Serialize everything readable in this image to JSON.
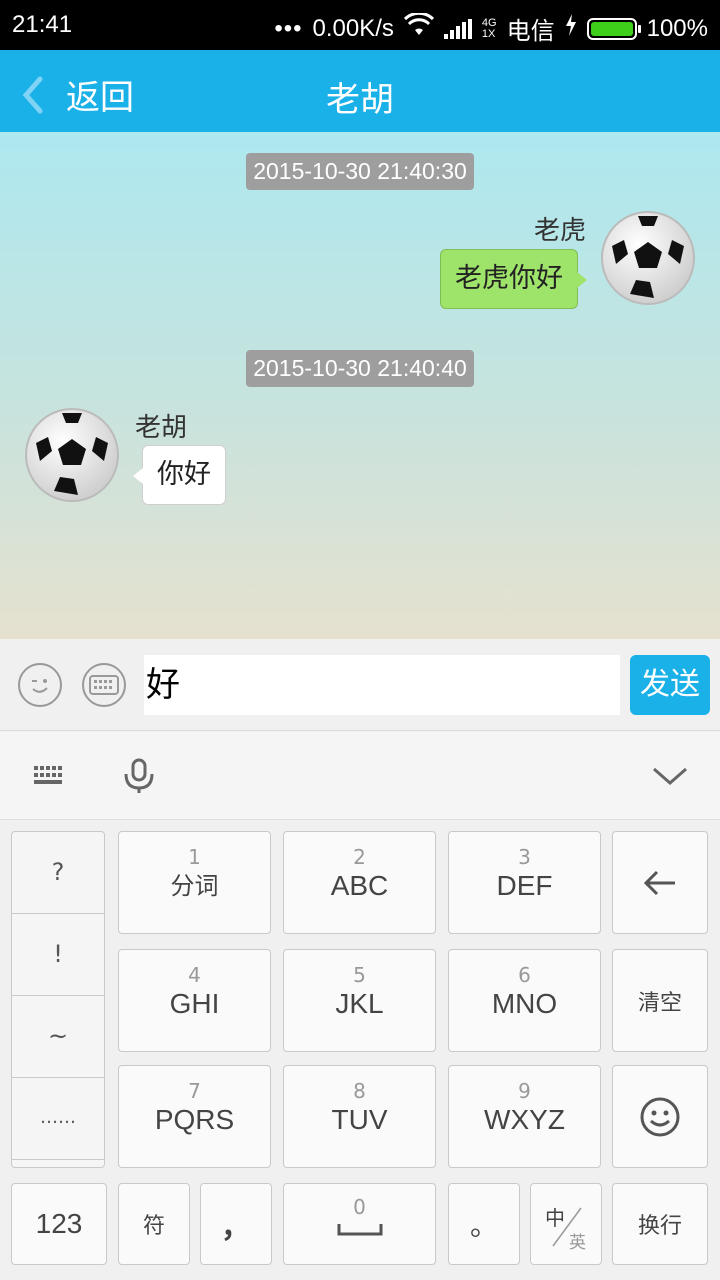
{
  "status_bar": {
    "time": "21:41",
    "dots": "•••",
    "speed": "0.00K/s",
    "network_top": "4G",
    "network_bottom": "1X",
    "carrier": "电信",
    "battery": "100%",
    "battery_level": 1.0
  },
  "header": {
    "back_label": "返回",
    "title": "老胡"
  },
  "messages": [
    {
      "timestamp": "2015-10-30 21:40:30",
      "sender": "老虎",
      "text": "老虎你好",
      "side": "right"
    },
    {
      "timestamp": "2015-10-30 21:40:40",
      "sender": "老胡",
      "text": "你好",
      "side": "left"
    }
  ],
  "input": {
    "value": "好",
    "send_label": "发送"
  },
  "keyboard": {
    "symbols": [
      "?",
      "!",
      "~",
      "……"
    ],
    "keys": [
      {
        "num": "1",
        "label": "分词"
      },
      {
        "num": "2",
        "label": "ABC"
      },
      {
        "num": "3",
        "label": "DEF"
      },
      {
        "num": "4",
        "label": "GHI"
      },
      {
        "num": "5",
        "label": "JKL"
      },
      {
        "num": "6",
        "label": "MNO"
      },
      {
        "num": "7",
        "label": "PQRS"
      },
      {
        "num": "8",
        "label": "TUV"
      },
      {
        "num": "9",
        "label": "WXYZ"
      }
    ],
    "clear_label": "清空",
    "numbers_label": "123",
    "symbol_label": "符",
    "comma_label": "，",
    "space_num": "0",
    "period_label": "。",
    "lang_top": "中",
    "lang_bottom": "英",
    "newline_label": "换行"
  },
  "colors": {
    "accent": "#1ab0e8",
    "my_bubble": "#9ee36a",
    "timestamp_bg": "#9e9e9e"
  }
}
